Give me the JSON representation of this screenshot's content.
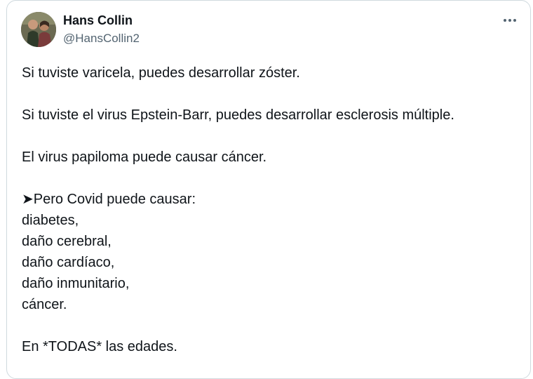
{
  "tweet": {
    "author_name": "Hans Collin",
    "author_handle": "@HansCollin2",
    "more_icon": "more-horizontal-icon",
    "lines": {
      "l1": "Si tuviste varicela, puedes desarrollar zóster.",
      "l2": "Si tuviste el virus Epstein-Barr, puedes desarrollar esclerosis múltiple.",
      "l3": "El virus papiloma puede causar cáncer.",
      "l4": "➤Pero Covid puede causar:",
      "l5": "diabetes,",
      "l6": "daño cerebral,",
      "l7": "daño cardíaco,",
      "l8": "daño inmunitario,",
      "l9": "cáncer.",
      "l10": "En *TODAS* las edades."
    }
  }
}
